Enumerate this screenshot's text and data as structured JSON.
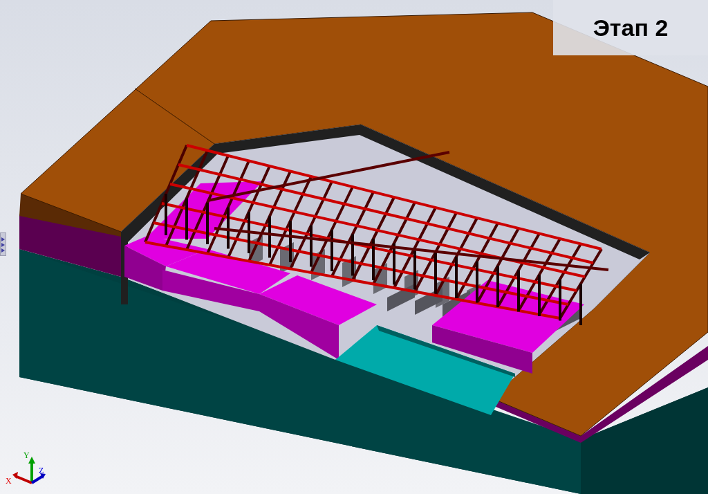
{
  "stage_label": "Этап 2",
  "axis_triad": {
    "labels": [
      "X",
      "Y",
      "Z"
    ]
  }
}
